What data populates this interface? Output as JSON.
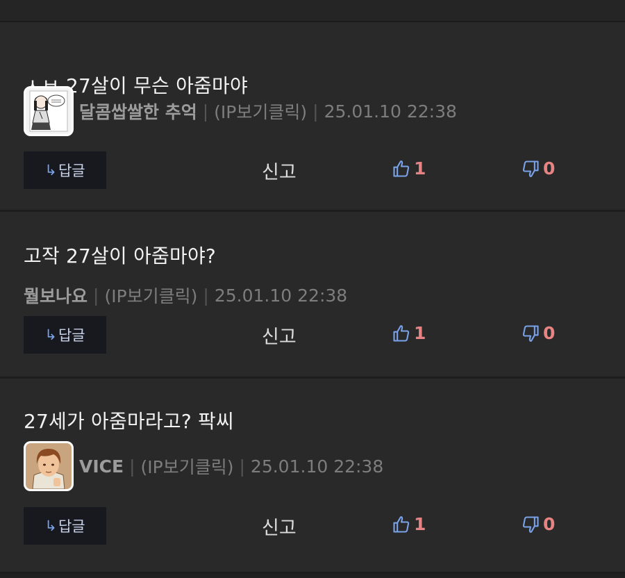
{
  "comments": [
    {
      "text": "ㅅㅂ 27살이 무슨 아줌마야",
      "nick": "달콤쌉쌀한 추억",
      "ip": "(IP보기클릭)",
      "time": "25.01.10 22:38",
      "reply_label": "답글",
      "reply_arrow": "↳",
      "report_label": "신고",
      "likes": "1",
      "dislikes": "0",
      "has_avatar": true,
      "avatar": "manga-girl-avatar"
    },
    {
      "text": "고작 27살이 아줌마야?",
      "nick": "뭘보나요",
      "ip": "(IP보기클릭)",
      "time": "25.01.10 22:38",
      "reply_label": "답글",
      "reply_arrow": "↳",
      "report_label": "신고",
      "likes": "1",
      "dislikes": "0",
      "has_avatar": false
    },
    {
      "text": "27세가 아줌마라고? 팍씨",
      "nick": "VICE",
      "ip": "(IP보기클릭)",
      "time": "25.01.10 22:38",
      "reply_label": "답글",
      "reply_arrow": "↳",
      "report_label": "신고",
      "likes": "1",
      "dislikes": "0",
      "has_avatar": true,
      "avatar": "game-character-avatar"
    }
  ],
  "colors": {
    "background": "#29292a",
    "like": "#e88383",
    "thumb_icon": "#7aa3ea",
    "reply_button_bg": "#17191e"
  }
}
